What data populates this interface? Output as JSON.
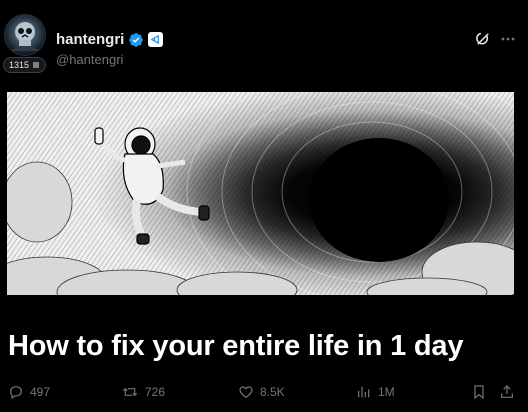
{
  "author": {
    "display_name": "hantengri",
    "handle": "@hantengri",
    "follower_badge": "1315"
  },
  "post": {
    "headline": "How to fix your entire life in 1 day"
  },
  "actions": {
    "replies": "497",
    "reposts": "726",
    "likes": "8.5K",
    "views": "1M"
  },
  "icons": {
    "verified": "verified-badge-icon",
    "affiliate": "affiliate-badge-icon",
    "grok": "grok-icon",
    "more": "more-icon",
    "reply": "reply-icon",
    "repost": "repost-icon",
    "like": "heart-icon",
    "views": "views-icon",
    "bookmark": "bookmark-icon",
    "share": "share-icon"
  },
  "colors": {
    "background": "#000000",
    "text": "#e7e9ea",
    "muted": "#71767b",
    "verified": "#1d9bf0"
  }
}
